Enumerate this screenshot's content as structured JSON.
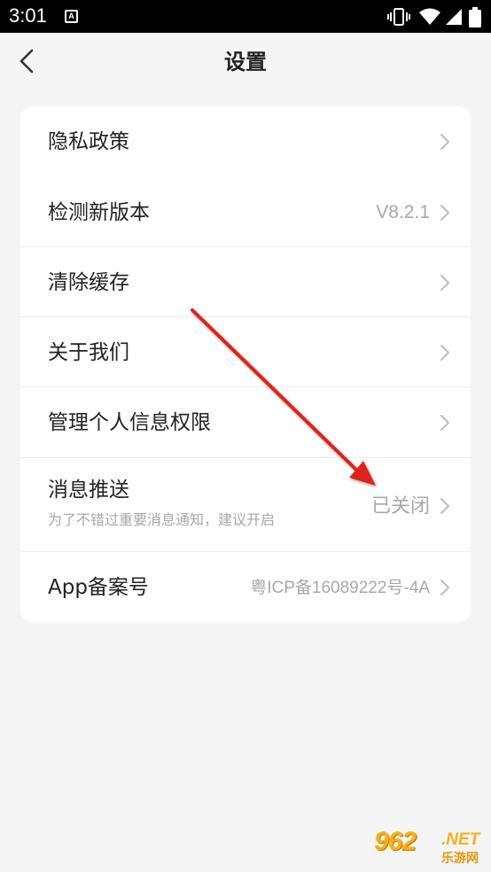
{
  "status_bar": {
    "time": "3:01",
    "notification_icon_letter": "A",
    "icons": [
      "vibrate-icon",
      "wifi-icon",
      "signal-icon",
      "battery-icon"
    ]
  },
  "header": {
    "title": "设置",
    "back_icon": "chevron-left-icon"
  },
  "settings": {
    "items": [
      {
        "label": "隐私政策",
        "value": "",
        "sub": ""
      },
      {
        "label": "检测新版本",
        "value": "V8.2.1",
        "sub": ""
      },
      {
        "label": "清除缓存",
        "value": "",
        "sub": ""
      },
      {
        "label": "关于我们",
        "value": "",
        "sub": ""
      },
      {
        "label": "管理个人信息权限",
        "value": "",
        "sub": ""
      },
      {
        "label": "消息推送",
        "value": "已关闭",
        "sub": "为了不错过重要消息通知，建议开启"
      },
      {
        "label": "App备案号",
        "value": "粤ICP备16089222号-4A",
        "sub": ""
      }
    ]
  },
  "annotation": {
    "arrow_color": "#e0201b"
  },
  "watermark": {
    "main": "962",
    "suffix": ".NET",
    "sub": "乐游网"
  },
  "colors": {
    "background": "#f5f5f5",
    "card": "#ffffff",
    "text_primary": "#222222",
    "text_secondary": "#a8a8a8"
  }
}
